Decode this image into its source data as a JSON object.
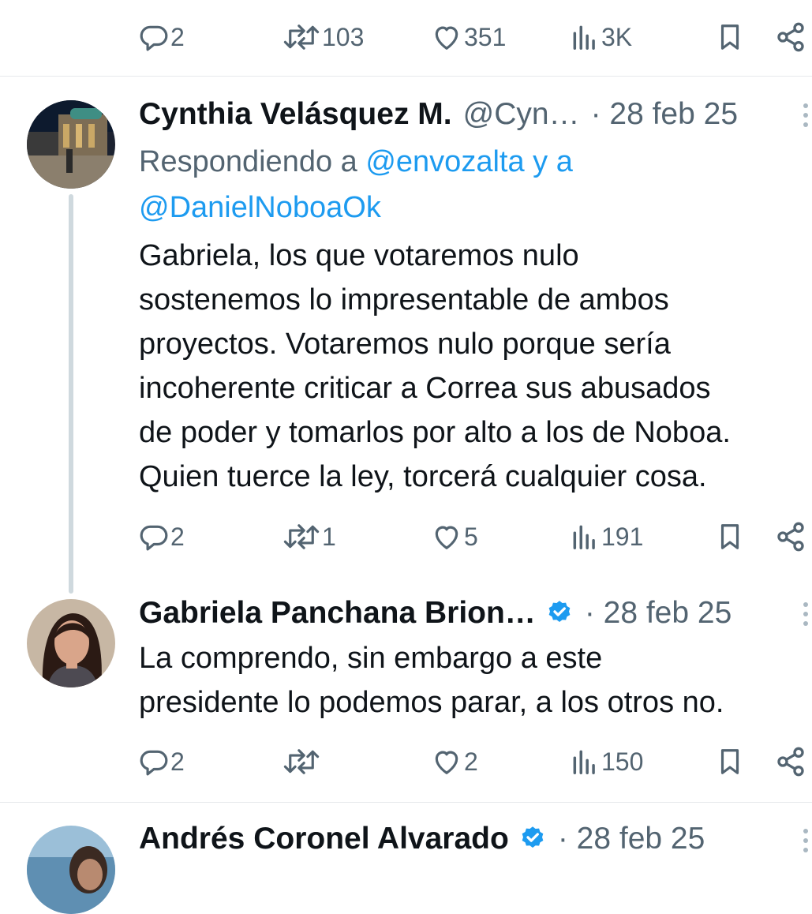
{
  "top_actions": {
    "replies": "2",
    "reposts": "103",
    "likes": "351",
    "views": "3K"
  },
  "tweets": [
    {
      "name": "Cynthia Velásquez M.",
      "handle": "@Cyn…",
      "date": "· 28 feb 25",
      "reply_prefix": "Respondiendo a ",
      "reply_user1": "@envozalta",
      "reply_joiner": " y a",
      "reply_user2": "@DanielNoboaOk",
      "lines": [
        "Gabriela, los que votaremos nulo",
        "sostenemos lo impresentable de ambos",
        "proyectos. Votaremos nulo porque sería",
        "incoherente criticar a Correa sus abusados",
        "de poder y tomarlos por alto a los de Noboa.",
        "Quien tuerce la ley, torcerá cualquier cosa."
      ],
      "actions": {
        "replies": "2",
        "reposts": "1",
        "likes": "5",
        "views": "191"
      }
    },
    {
      "name": "Gabriela Panchana Brion…",
      "verified": true,
      "date": "· 28 feb 25",
      "lines": [
        "La comprendo, sin embargo a este",
        "presidente lo podemos parar, a los otros no."
      ],
      "actions": {
        "replies": "2",
        "reposts": "",
        "likes": "2",
        "views": "150"
      }
    },
    {
      "name": "Andrés Coronel Alvarado",
      "verified": true,
      "date": "· 28 feb 25"
    }
  ],
  "colors": {
    "text": "#0f1419",
    "secondary": "#536471",
    "link": "#1d9bf0",
    "verified": "#1d9bf0",
    "divider": "#e6e9ec"
  },
  "icons": [
    "reply-icon",
    "repost-icon",
    "like-icon",
    "views-icon",
    "bookmark-icon",
    "share-icon",
    "verified-badge-icon",
    "more-icon"
  ]
}
